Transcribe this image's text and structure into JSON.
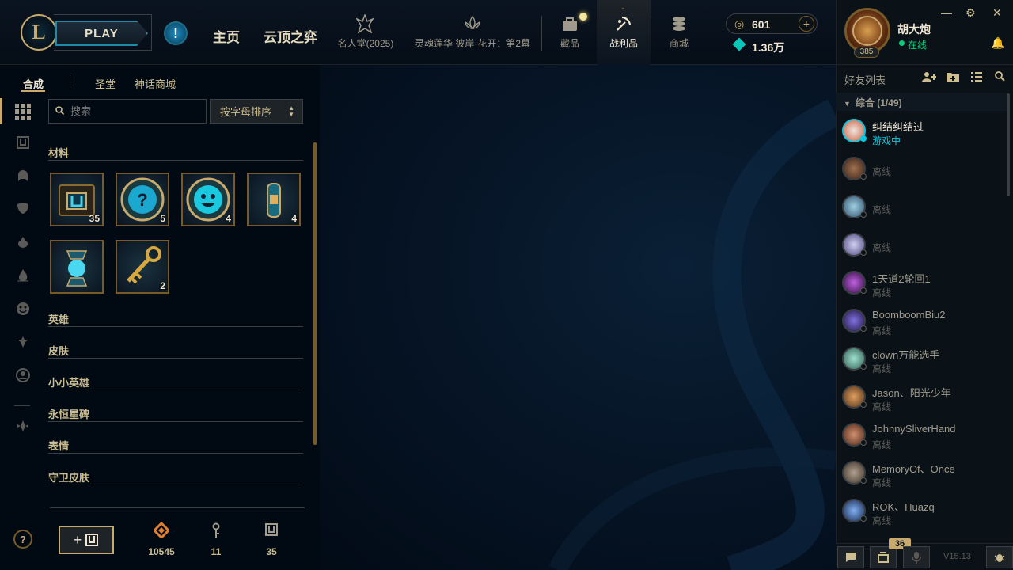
{
  "header": {
    "play_label": "PLAY",
    "nav_main": [
      "主页",
      "云顶之弈"
    ],
    "nav_events": [
      "名人堂(2025)",
      "灵魂莲华 彼岸·花开：第2幕"
    ],
    "nav_shop": [
      "藏品",
      "战利品",
      "商城"
    ],
    "rp_value": "601",
    "be_value": "1.36万"
  },
  "profile": {
    "name": "胡大炮",
    "status": "在线",
    "level": "385"
  },
  "loot": {
    "subtabs": [
      "合成",
      "圣堂",
      "神话商城"
    ],
    "search_placeholder": "搜索",
    "sort_label": "按字母排序",
    "sections": [
      "材料",
      "英雄",
      "皮肤",
      "小小英雄",
      "永恒星碑",
      "表情",
      "守卫皮肤"
    ],
    "materials": [
      {
        "icon": "hextech-chest-icon",
        "count": "35"
      },
      {
        "icon": "mystery-emote-icon",
        "count": "5"
      },
      {
        "icon": "emote-icon",
        "count": "4"
      },
      {
        "icon": "capsule-icon",
        "count": "4"
      },
      {
        "icon": "orb-capsule-icon",
        "count": ""
      },
      {
        "icon": "key-icon",
        "count": "2"
      }
    ],
    "footer": {
      "essence_value": "10545",
      "keys_value": "11",
      "chests_value": "35"
    }
  },
  "friends": {
    "title": "好友列表",
    "group_label": "综合 (1/49)",
    "list": [
      {
        "name": "纠结纠结过",
        "status": "游戏中"
      },
      {
        "name": "",
        "status": "离线"
      },
      {
        "name": "",
        "status": "离线"
      },
      {
        "name": "",
        "status": "离线"
      },
      {
        "name": "1天道2轮回1",
        "status": "离线"
      },
      {
        "name": "BoomboomBiu2",
        "status": "离线"
      },
      {
        "name": "clown万能选手",
        "status": "离线"
      },
      {
        "name": "Jason、阳光少年",
        "status": "离线"
      },
      {
        "name": "JohnnySliverHand",
        "status": "离线"
      },
      {
        "name": "MemoryOf、Once",
        "status": "离线"
      },
      {
        "name": "ROK、Huazq",
        "status": "离线"
      }
    ],
    "badge": "36",
    "version": "V15.13"
  },
  "colors": {
    "gold": "#c8aa6e",
    "online": "#0acb76",
    "ingame": "#0ac8e0",
    "bg": "#010a13"
  }
}
